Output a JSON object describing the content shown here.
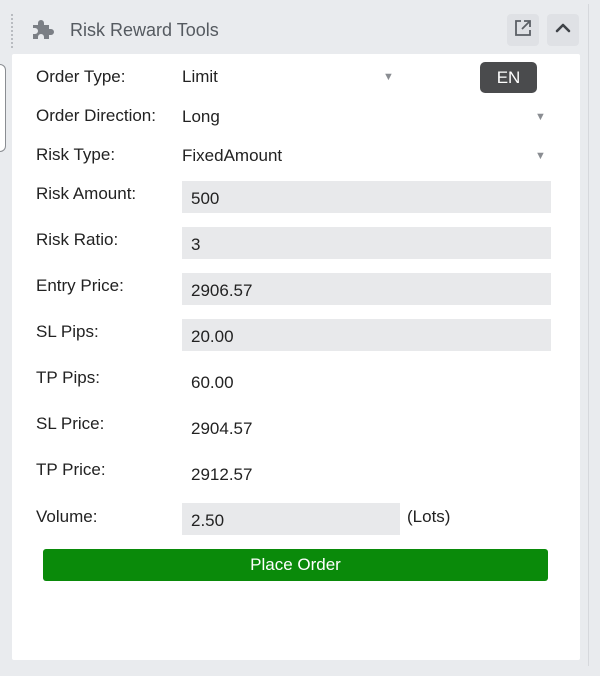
{
  "header": {
    "title": "Risk Reward Tools",
    "icon": "puzzle-piece-icon",
    "external_icon": "external-link-icon",
    "collapse_icon": "chevron-up-icon"
  },
  "language": {
    "label": "EN"
  },
  "form": {
    "order_type": {
      "label": "Order Type:",
      "value": "Limit"
    },
    "order_direction": {
      "label": "Order Direction:",
      "value": "Long"
    },
    "risk_type": {
      "label": "Risk Type:",
      "value": "FixedAmount"
    },
    "risk_amount": {
      "label": "Risk Amount:",
      "value": "500"
    },
    "risk_ratio": {
      "label": "Risk Ratio:",
      "value": "3"
    },
    "entry_price": {
      "label": "Entry Price:",
      "value": "2906.57"
    },
    "sl_pips": {
      "label": "SL Pips:",
      "value": "20.00"
    },
    "tp_pips": {
      "label": "TP Pips:",
      "value": "60.00"
    },
    "sl_price": {
      "label": "SL Price:",
      "value": "2904.57"
    },
    "tp_price": {
      "label": "TP Price:",
      "value": "2912.57"
    },
    "volume": {
      "label": "Volume:",
      "value": "2.50",
      "unit": "(Lots)"
    }
  },
  "actions": {
    "place_order": "Place Order"
  },
  "colors": {
    "place_order_bg": "#0a8a0a",
    "language_button_bg": "#4a4b4d",
    "input_bg": "#e8e9eb"
  }
}
